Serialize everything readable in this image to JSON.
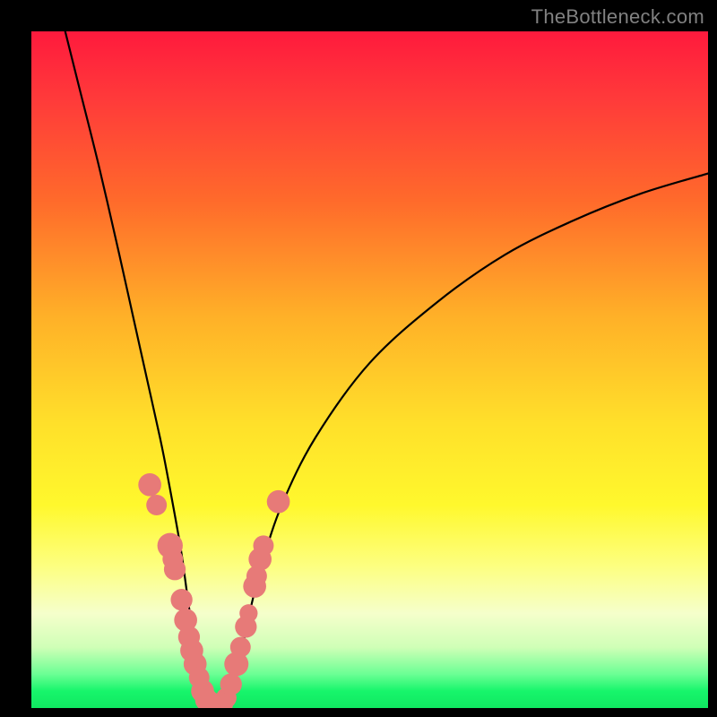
{
  "watermark": "TheBottleneck.com",
  "colors": {
    "frame": "#000000",
    "curve": "#000000",
    "dots": "#e77a78",
    "gradient_top": "#ff1a3d",
    "gradient_bottom": "#10e861"
  },
  "chart_data": {
    "type": "line",
    "title": "",
    "xlabel": "",
    "ylabel": "",
    "xlim": [
      0,
      100
    ],
    "ylim": [
      0,
      100
    ],
    "note": "Bottleneck curve. x ≈ hardware-balance position (arbitrary 0–100 across width). y ≈ bottleneck percentage (0 at bottom = no bottleneck, 100 at top = full bottleneck). Minimum of the curve sits near x≈25–28, y≈0. Values estimated from pixel positions; no axis tick labels are rendered.",
    "series": [
      {
        "name": "bottleneck-curve",
        "x": [
          5,
          7,
          10,
          13,
          15,
          17,
          19,
          20,
          22,
          23,
          24,
          25,
          26,
          27,
          28,
          29,
          30,
          31,
          32,
          34,
          37,
          42,
          50,
          60,
          70,
          80,
          90,
          100
        ],
        "y": [
          100,
          92,
          80,
          67,
          58,
          49,
          40,
          35,
          24,
          17,
          10,
          4,
          1,
          0,
          0,
          1,
          4,
          8,
          13,
          21,
          30,
          40,
          51,
          60,
          67,
          72,
          76,
          79
        ]
      }
    ],
    "highlight_points": {
      "name": "sample-dots",
      "note": "Salmon dots clustered near the curve's minimum on both flanks.",
      "points": [
        {
          "x": 17.5,
          "y": 33,
          "r": 1.3
        },
        {
          "x": 18.5,
          "y": 30,
          "r": 1.1
        },
        {
          "x": 20.5,
          "y": 24,
          "r": 1.5
        },
        {
          "x": 20.9,
          "y": 22,
          "r": 1.1
        },
        {
          "x": 21.2,
          "y": 20.5,
          "r": 1.2
        },
        {
          "x": 22.2,
          "y": 16,
          "r": 1.2
        },
        {
          "x": 22.8,
          "y": 13,
          "r": 1.3
        },
        {
          "x": 23.3,
          "y": 10.5,
          "r": 1.2
        },
        {
          "x": 23.7,
          "y": 8.5,
          "r": 1.3
        },
        {
          "x": 24.2,
          "y": 6.5,
          "r": 1.3
        },
        {
          "x": 24.8,
          "y": 4.5,
          "r": 1.1
        },
        {
          "x": 25.3,
          "y": 2.5,
          "r": 1.3
        },
        {
          "x": 25.9,
          "y": 1.2,
          "r": 1.3
        },
        {
          "x": 26.5,
          "y": 0.6,
          "r": 1.4
        },
        {
          "x": 27.3,
          "y": 0.4,
          "r": 1.4
        },
        {
          "x": 28.1,
          "y": 0.6,
          "r": 1.3
        },
        {
          "x": 28.8,
          "y": 1.5,
          "r": 1.1
        },
        {
          "x": 29.5,
          "y": 3.5,
          "r": 1.2
        },
        {
          "x": 30.3,
          "y": 6.5,
          "r": 1.4
        },
        {
          "x": 30.9,
          "y": 9,
          "r": 1.1
        },
        {
          "x": 31.7,
          "y": 12,
          "r": 1.2
        },
        {
          "x": 32.1,
          "y": 14,
          "r": 0.9
        },
        {
          "x": 33.0,
          "y": 18,
          "r": 1.3
        },
        {
          "x": 33.3,
          "y": 19.5,
          "r": 1.1
        },
        {
          "x": 33.8,
          "y": 22,
          "r": 1.3
        },
        {
          "x": 34.3,
          "y": 24,
          "r": 1.1
        },
        {
          "x": 36.5,
          "y": 30.5,
          "r": 1.3
        }
      ]
    }
  }
}
